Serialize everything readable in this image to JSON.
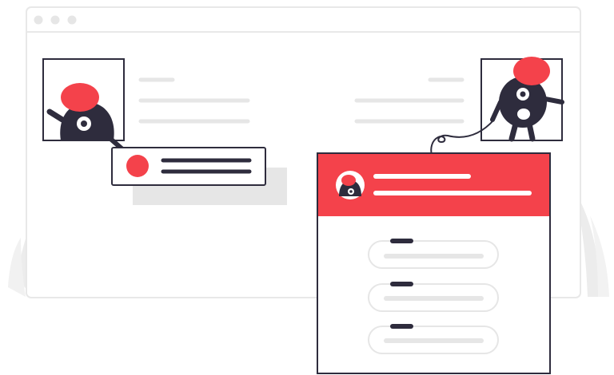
{
  "colors": {
    "accent": "#F4424B",
    "dark": "#2E2C3D",
    "line": "#E6E6E6",
    "line_soft": "#EEEEEE",
    "frame": "#E8E8E8",
    "plant": "#E9E9E9",
    "white": "#FFFFFF"
  },
  "icons": {
    "browser_dots": "three-gray-dots",
    "left_avatar": "red-hat-monster",
    "right_avatar": "red-hat-monster-standing",
    "card_avatar": "mini-monster"
  },
  "card": {
    "list_items": 3
  }
}
